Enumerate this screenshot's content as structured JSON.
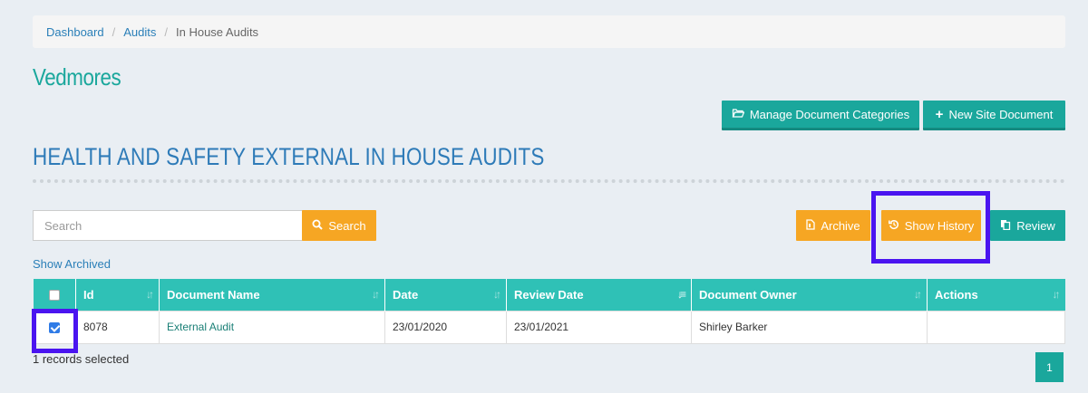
{
  "breadcrumb": {
    "items": [
      "Dashboard",
      "Audits"
    ],
    "current": "In House Audits"
  },
  "site_title": "Vedmores",
  "toolbar": {
    "manage_label": "Manage Document Categories",
    "new_label": "New Site Document"
  },
  "section_title": "HEALTH AND SAFETY EXTERNAL IN HOUSE AUDITS",
  "search": {
    "placeholder": "Search",
    "button_label": "Search"
  },
  "actions": {
    "archive": "Archive",
    "show_history": "Show History",
    "review": "Review"
  },
  "show_archived": "Show Archived",
  "table": {
    "headers": [
      "Id",
      "Document Name",
      "Date",
      "Review Date",
      "Document Owner",
      "Actions"
    ],
    "rows": [
      {
        "checked": true,
        "id": "8078",
        "name": "External Audit",
        "date": "23/01/2020",
        "review_date": "23/01/2021",
        "owner": "Shirley Barker",
        "actions": ""
      }
    ]
  },
  "records_selected": "1 records selected",
  "pagination": {
    "current_page": "1"
  },
  "colors": {
    "teal": "#1aa79c",
    "header_teal": "#2fc1b6",
    "orange": "#f6a623",
    "highlight": "#4a14f0",
    "link": "#2a7fb8"
  }
}
